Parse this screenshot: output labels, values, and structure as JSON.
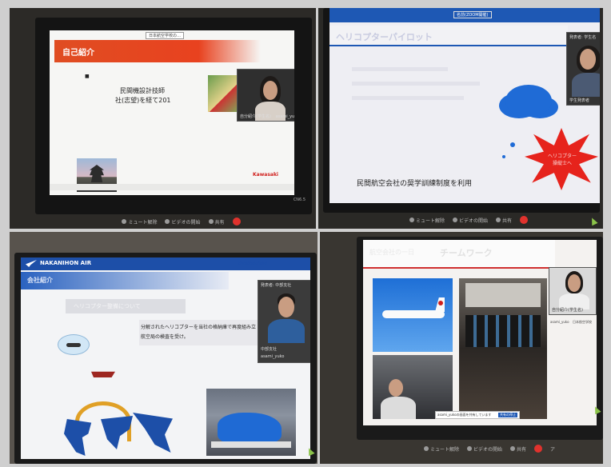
{
  "panels": {
    "top_left": {
      "slide_title": "自己紹介",
      "header_tag": "日本航空学校の…",
      "body_mark": "■",
      "body_line1": "民間機設計技師",
      "body_line2": "社(志望)を経て201",
      "footer_logo": "Kawasaki",
      "video_caption": "自分紹介(学生名)",
      "video_name": "asami_yuko",
      "zoom_level": "CN6.5"
    },
    "top_right": {
      "header_tag": "名前(ZOOM開催)",
      "slide_title": "ヘリコプターパイロット",
      "body_text": "民間航空会社の奨学訓練制度を利用",
      "star_label": "ヘリコプター\n操縦士へ",
      "video_top": "発表者: 学生名",
      "video_caption": "学生発表者"
    },
    "bottom_left": {
      "brand": "NAKANIHON AIR",
      "brand_right": "Nakanihon",
      "section_label": "会社紹介",
      "subtitle": "ヘリコプター整備について",
      "body_line1": "分解されたヘリコプターを当社の格納庫で再度組み立",
      "body_line2": "航空局の検査を受け。",
      "video_top": "発表者: 中部支社",
      "video_caption": "中部支社",
      "video_name": "asami_yuko"
    },
    "bottom_right": {
      "slide_title": "航空会社の一日",
      "slide_title_outline": "チームワーク",
      "video_caption": "自分紹介(学生名)",
      "video_name": "asami_yuko",
      "video_name2": "日本航空学校",
      "share_text": "asami_yukoの画面を共有しています",
      "share_stop": "共有の停止"
    }
  },
  "toolbar": {
    "mute": "ミュート解除",
    "video": "ビデオの開始",
    "share": "共有",
    "leave": "ア"
  },
  "colors": {
    "zoom_red": "#e0322d",
    "kawasaki_red": "#d0201d",
    "slide_blue": "#1e58b4",
    "map_blue": "#1d4fa8",
    "star_red": "#e6231c"
  }
}
